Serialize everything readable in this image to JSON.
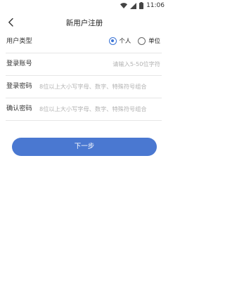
{
  "status_bar": {
    "time": "11:06"
  },
  "nav": {
    "title": "新用户注册"
  },
  "form": {
    "user_type": {
      "label": "用户类型",
      "options": [
        {
          "label": "个人",
          "selected": true
        },
        {
          "label": "单位",
          "selected": false
        }
      ]
    },
    "account": {
      "label": "登录账号",
      "placeholder": "请输入5-50位字符"
    },
    "password": {
      "label": "登录密码",
      "placeholder": "8位以上大小写字母、数字、特殊符号组合"
    },
    "confirm_password": {
      "label": "确认密码",
      "placeholder": "8位以上大小写字母、数字、特殊符号组合"
    }
  },
  "next_button": {
    "label": "下一步"
  },
  "colors": {
    "accent": "#4a78d1",
    "radio_selected": "#3b74d6",
    "divider": "#e6e6e6",
    "placeholder": "#b3b3b3"
  }
}
